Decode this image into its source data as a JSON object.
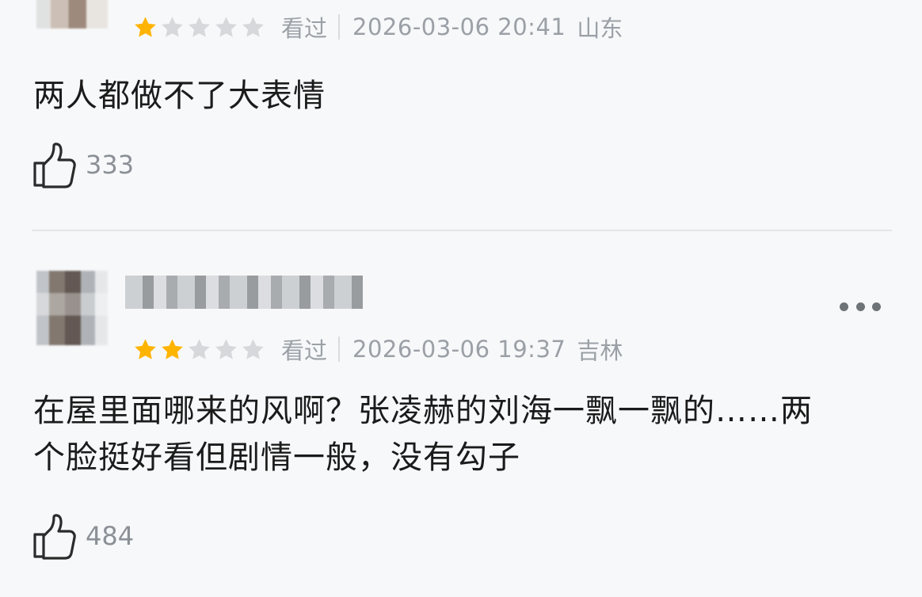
{
  "reviews": [
    {
      "rating": 1,
      "rating_max": 5,
      "watched_label": "看过",
      "time": "2026-03-06 20:41",
      "location": "山东",
      "content": "两人都做不了大表情",
      "likes": "333",
      "icons": {
        "like": "thumbs-up-icon"
      }
    },
    {
      "rating": 2,
      "rating_max": 5,
      "watched_label": "看过",
      "time": "2026-03-06 19:37",
      "location": "吉林",
      "content": "在屋里面哪来的风啊？张凌赫的刘海一飘一飘的……两个脸挺好看但剧情一般，没有勾子",
      "likes": "484",
      "icons": {
        "like": "thumbs-up-icon",
        "more": "more-icon"
      }
    }
  ],
  "colors": {
    "star_on": "#ffb400",
    "star_off": "#d6d8db",
    "meta_text": "#9aa0a6",
    "background": "#f7f8fa"
  }
}
